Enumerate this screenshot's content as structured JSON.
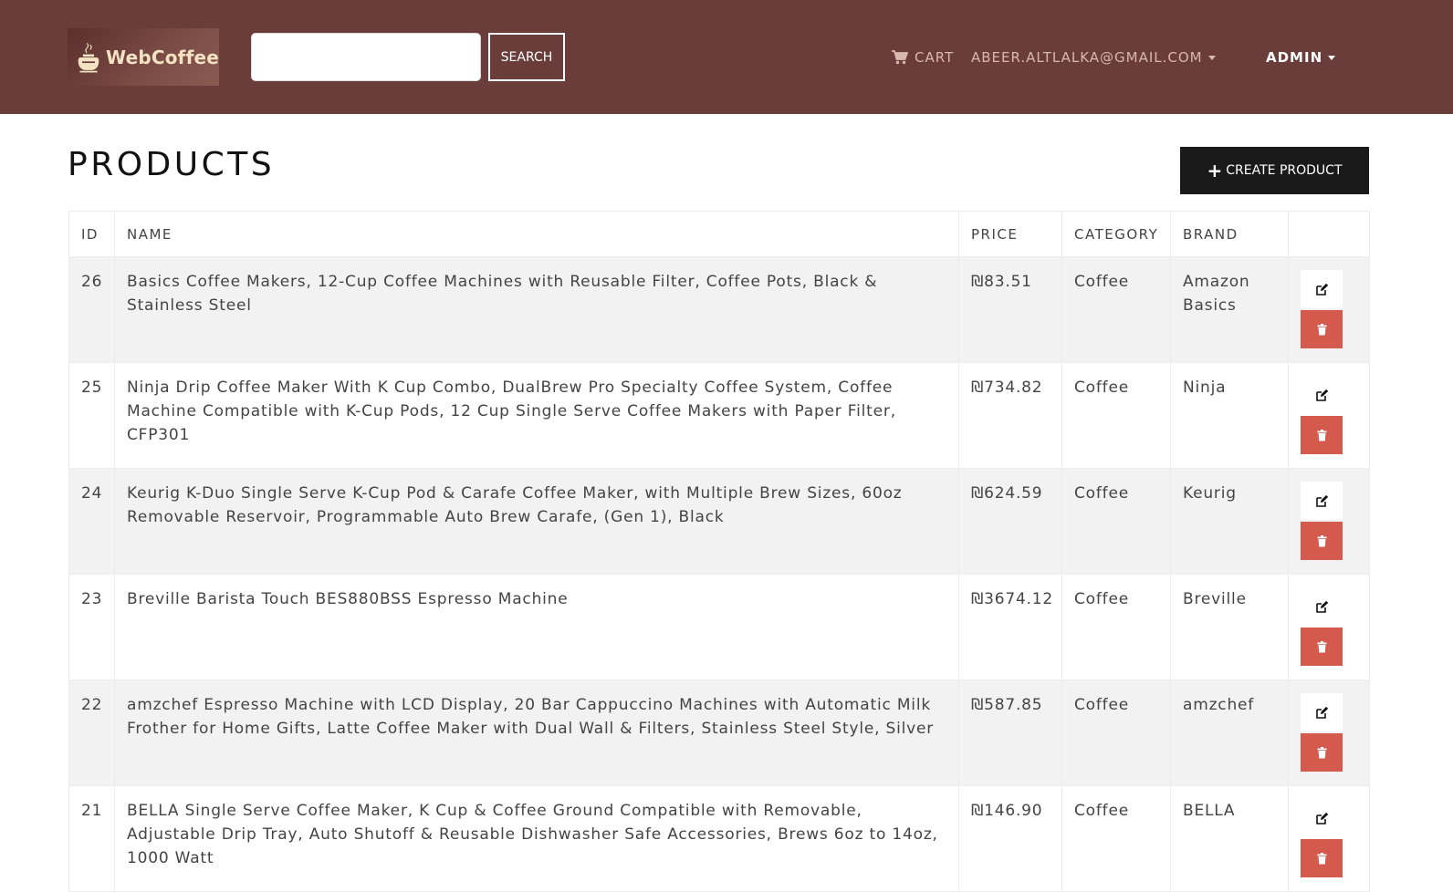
{
  "navbar": {
    "brand": "WebCoffee",
    "search": {
      "placeholder": "",
      "value": "",
      "button": "SEARCH"
    },
    "cart": "CART",
    "email": "ABEER.ALTLALKA@GMAIL.COM",
    "admin": "ADMIN"
  },
  "page": {
    "title": "PRODUCTS",
    "create_button": "CREATE PRODUCT"
  },
  "table": {
    "headers": {
      "id": "ID",
      "name": "NAME",
      "price": "PRICE",
      "category": "CATEGORY",
      "brand": "BRAND"
    },
    "rows": [
      {
        "id": "26",
        "name": "Basics Coffee Makers, 12-Cup Coffee Machines with Reusable Filter, Coffee Pots, Black & Stainless Steel",
        "price": "₪83.51",
        "category": "Coffee",
        "brand": "Amazon Basics"
      },
      {
        "id": "25",
        "name": "Ninja Drip Coffee Maker With K Cup Combo, DualBrew Pro Specialty Coffee System, Coffee Machine Compatible with K-Cup Pods, 12 Cup Single Serve Coffee Makers with Paper Filter, CFP301",
        "price": "₪734.82",
        "category": "Coffee",
        "brand": "Ninja"
      },
      {
        "id": "24",
        "name": "Keurig K-Duo Single Serve K-Cup Pod & Carafe Coffee Maker, with Multiple Brew Sizes, 60oz Removable Reservoir, Programmable Auto Brew Carafe, (Gen 1), Black",
        "price": "₪624.59",
        "category": "Coffee",
        "brand": "Keurig"
      },
      {
        "id": "23",
        "name": "Breville Barista Touch BES880BSS Espresso Machine",
        "price": "₪3674.12",
        "category": "Coffee",
        "brand": "Breville"
      },
      {
        "id": "22",
        "name": "amzchef Espresso Machine with LCD Display, 20 Bar Cappuccino Machines with Automatic Milk Frother for Home Gifts, Latte Coffee Maker with Dual Wall & Filters, Stainless Steel Style, Silver",
        "price": "₪587.85",
        "category": "Coffee",
        "brand": "amzchef"
      },
      {
        "id": "21",
        "name": "BELLA Single Serve Coffee Maker, K Cup & Coffee Ground Compatible with Removable, Adjustable Drip Tray, Auto Shutoff & Reusable Dishwasher Safe Accessories, Brews 6oz to 14oz, 1000 Watt",
        "price": "₪146.90",
        "category": "Coffee",
        "brand": "BELLA"
      }
    ]
  },
  "colors": {
    "navbar": "#6a3c3a",
    "delete": "#d35a4c",
    "create": "#1a1a1a"
  }
}
